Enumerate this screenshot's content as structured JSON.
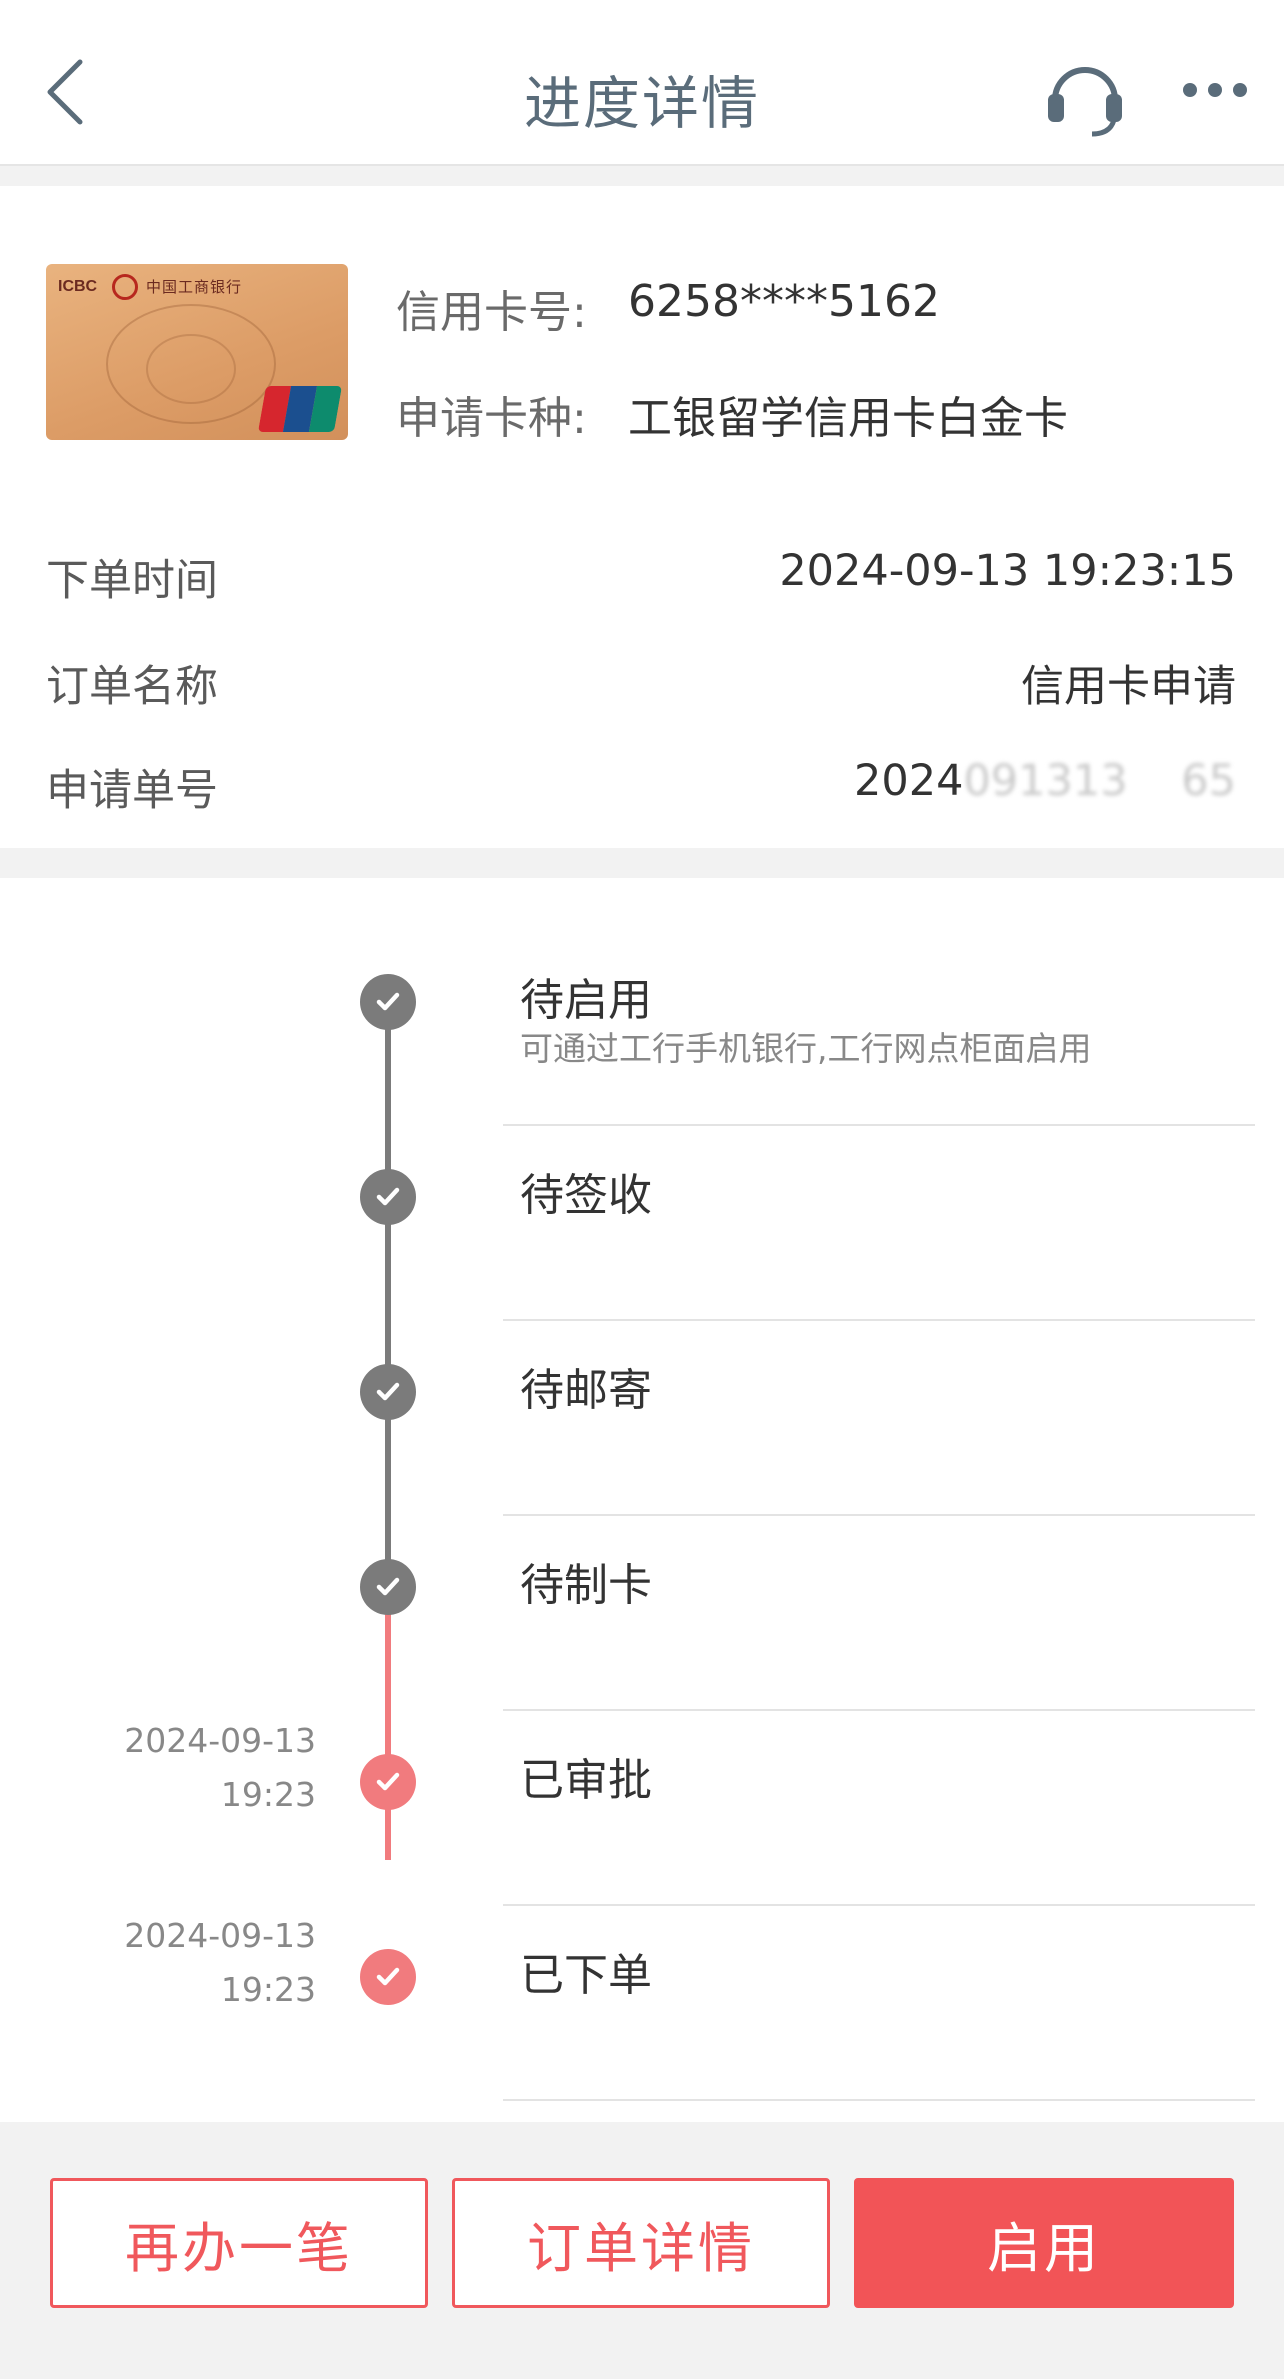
{
  "header": {
    "title": "进度详情",
    "back_icon": "chevron-left-icon",
    "service_icon": "headset-icon",
    "more_icon": "more-horizontal-icon"
  },
  "card": {
    "bank_abbr": "ICBC",
    "bank_name": "中国工商银行",
    "number_label": "信用卡号:",
    "number_value": "6258****5162",
    "type_label": "申请卡种:",
    "type_value": "工银留学信用卡白金卡"
  },
  "order": {
    "time_label": "下单时间",
    "time_value": "2024-09-13 19:23:15",
    "name_label": "订单名称",
    "name_value": "信用卡申请",
    "id_label": "申请单号",
    "id_value_visible": "2024",
    "id_value_blurred": "091313",
    "id_value_tail": "65"
  },
  "timeline": [
    {
      "title": "待启用",
      "subtitle": "可通过工行手机银行,工行网点柜面启用",
      "status": "pending",
      "date": "",
      "time": ""
    },
    {
      "title": "待签收",
      "subtitle": "",
      "status": "pending",
      "date": "",
      "time": ""
    },
    {
      "title": "待邮寄",
      "subtitle": "",
      "status": "pending",
      "date": "",
      "time": ""
    },
    {
      "title": "待制卡",
      "subtitle": "",
      "status": "pending",
      "date": "",
      "time": ""
    },
    {
      "title": "已审批",
      "subtitle": "",
      "status": "done",
      "date": "2024-09-13",
      "time": "19:23"
    },
    {
      "title": "已下单",
      "subtitle": "",
      "status": "done",
      "date": "2024-09-13",
      "time": "19:23"
    }
  ],
  "colors": {
    "pending": "#7b7b7b",
    "done": "#f17b7e",
    "accent": "#f25457"
  },
  "actions": {
    "apply_again": "再办一笔",
    "order_detail": "订单详情",
    "activate": "启用"
  }
}
